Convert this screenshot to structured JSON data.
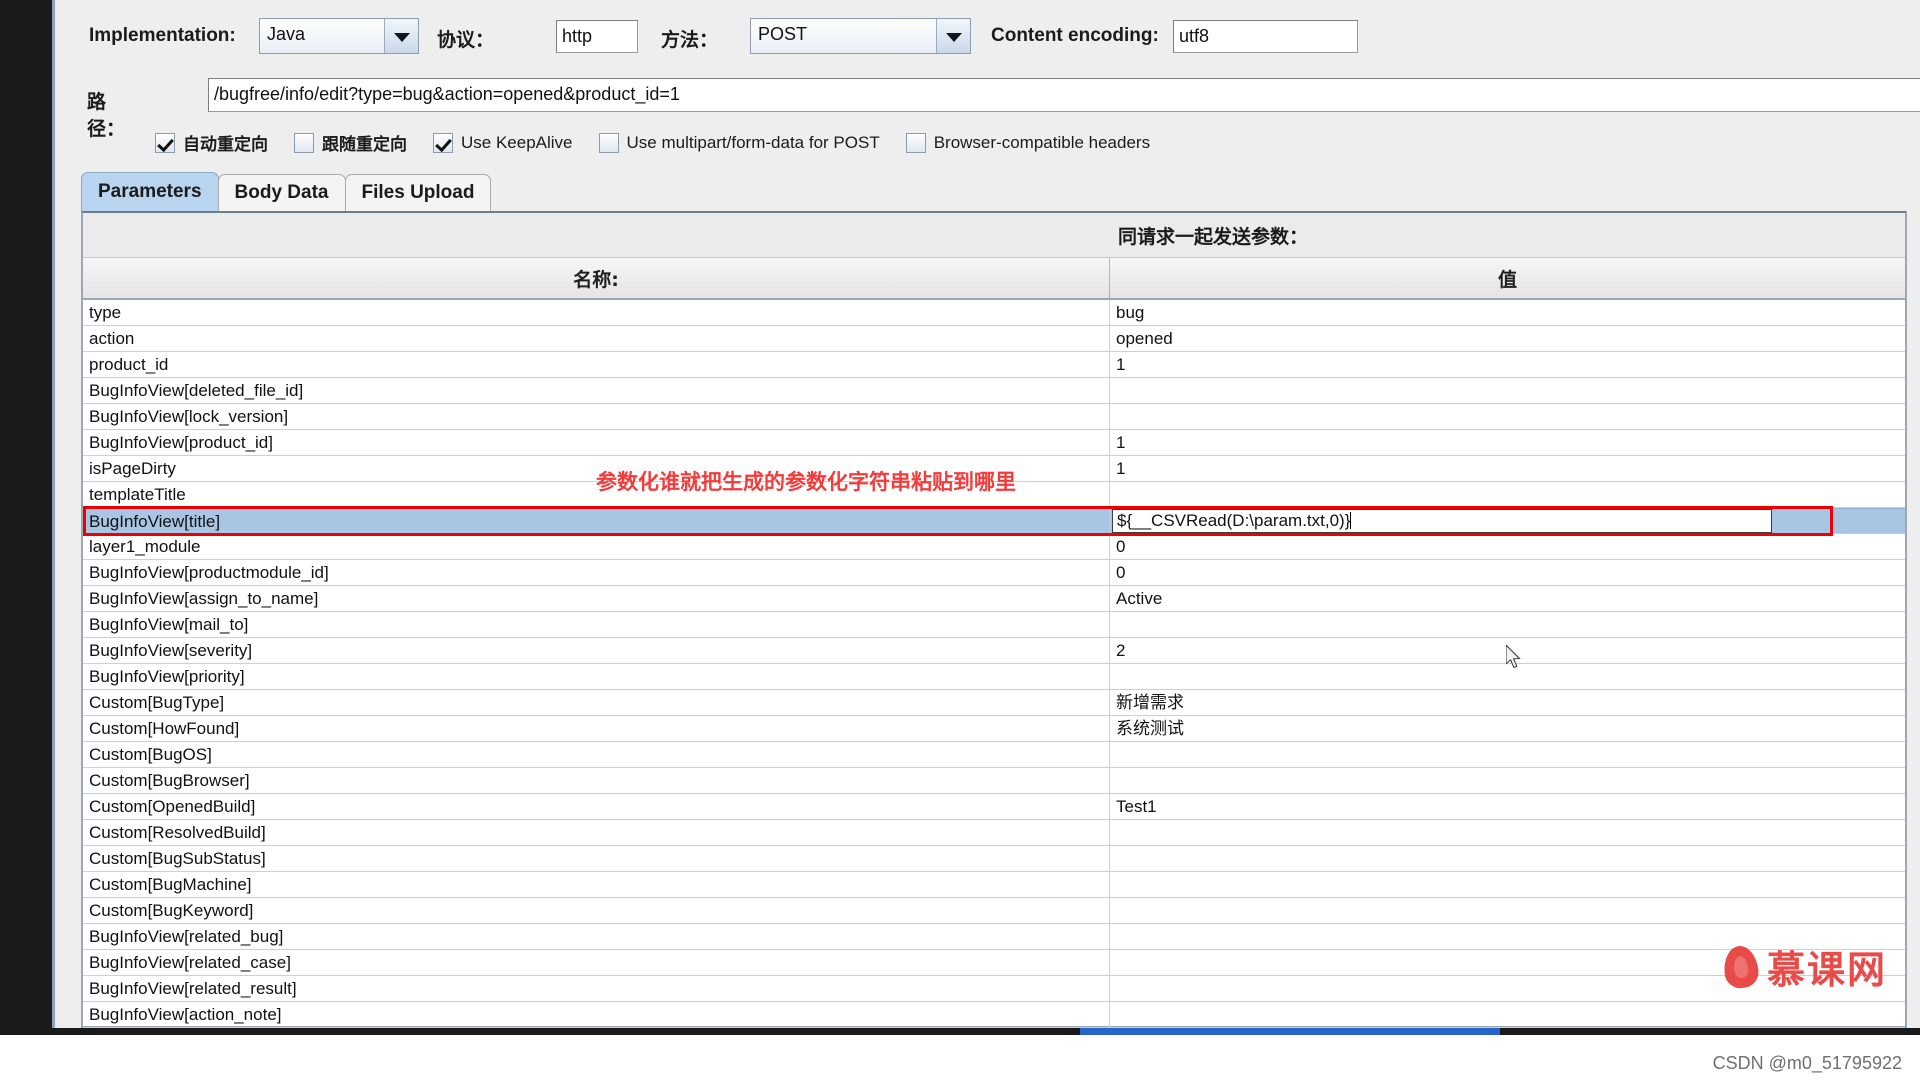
{
  "toolbar": {
    "implementation_label": "Implementation:",
    "implementation_value": "Java",
    "protocol_label": "协议：",
    "protocol_value": "http",
    "method_label": "方法：",
    "method_value": "POST",
    "encoding_label": "Content encoding:",
    "encoding_value": "utf8",
    "path_label": "路径：",
    "path_value": "/bugfree/info/edit?type=bug&action=opened&product_id=1"
  },
  "options": [
    {
      "label": "自动重定向",
      "checked": true,
      "cjk": true
    },
    {
      "label": "跟随重定向",
      "checked": false,
      "cjk": true
    },
    {
      "label": "Use KeepAlive",
      "checked": true,
      "cjk": false
    },
    {
      "label": "Use multipart/form-data for POST",
      "checked": false,
      "cjk": false
    },
    {
      "label": "Browser-compatible headers",
      "checked": false,
      "cjk": false
    }
  ],
  "tabs": [
    {
      "label": "Parameters",
      "active": true
    },
    {
      "label": "Body Data",
      "active": false
    },
    {
      "label": "Files Upload",
      "active": false
    }
  ],
  "table": {
    "caption": "同请求一起发送参数：",
    "columns": [
      "名称:",
      "值"
    ],
    "editing_value": "${__CSVRead(D:\\param.txt,0)}",
    "rows": [
      {
        "name": "type",
        "value": "bug"
      },
      {
        "name": "action",
        "value": "opened"
      },
      {
        "name": "product_id",
        "value": "1"
      },
      {
        "name": "BugInfoView[deleted_file_id]",
        "value": ""
      },
      {
        "name": "BugInfoView[lock_version]",
        "value": ""
      },
      {
        "name": "BugInfoView[product_id]",
        "value": "1"
      },
      {
        "name": "isPageDirty",
        "value": "1"
      },
      {
        "name": "templateTitle",
        "value": ""
      },
      {
        "name": "BugInfoView[title]",
        "value": "${__CSVRead(D:\\param.txt,0)}",
        "selected": true
      },
      {
        "name": "layer1_module",
        "value": "0"
      },
      {
        "name": "BugInfoView[productmodule_id]",
        "value": "0"
      },
      {
        "name": "BugInfoView[assign_to_name]",
        "value": "Active"
      },
      {
        "name": "BugInfoView[mail_to]",
        "value": ""
      },
      {
        "name": "BugInfoView[severity]",
        "value": "2"
      },
      {
        "name": "BugInfoView[priority]",
        "value": ""
      },
      {
        "name": "Custom[BugType]",
        "value": "新增需求",
        "cjk": true
      },
      {
        "name": "Custom[HowFound]",
        "value": "系统测试",
        "cjk": true
      },
      {
        "name": "Custom[BugOS]",
        "value": ""
      },
      {
        "name": "Custom[BugBrowser]",
        "value": ""
      },
      {
        "name": "Custom[OpenedBuild]",
        "value": "Test1"
      },
      {
        "name": "Custom[ResolvedBuild]",
        "value": ""
      },
      {
        "name": "Custom[BugSubStatus]",
        "value": ""
      },
      {
        "name": "Custom[BugMachine]",
        "value": ""
      },
      {
        "name": "Custom[BugKeyword]",
        "value": ""
      },
      {
        "name": "BugInfoView[related_bug]",
        "value": ""
      },
      {
        "name": "BugInfoView[related_case]",
        "value": ""
      },
      {
        "name": "BugInfoView[related_result]",
        "value": ""
      },
      {
        "name": "BugInfoView[action_note]",
        "value": ""
      }
    ]
  },
  "annotation": "参数化谁就把生成的参数化字符串粘贴到哪里",
  "watermark": {
    "text": "慕课网"
  },
  "footer": {
    "credit": "CSDN @m0_51795922"
  }
}
